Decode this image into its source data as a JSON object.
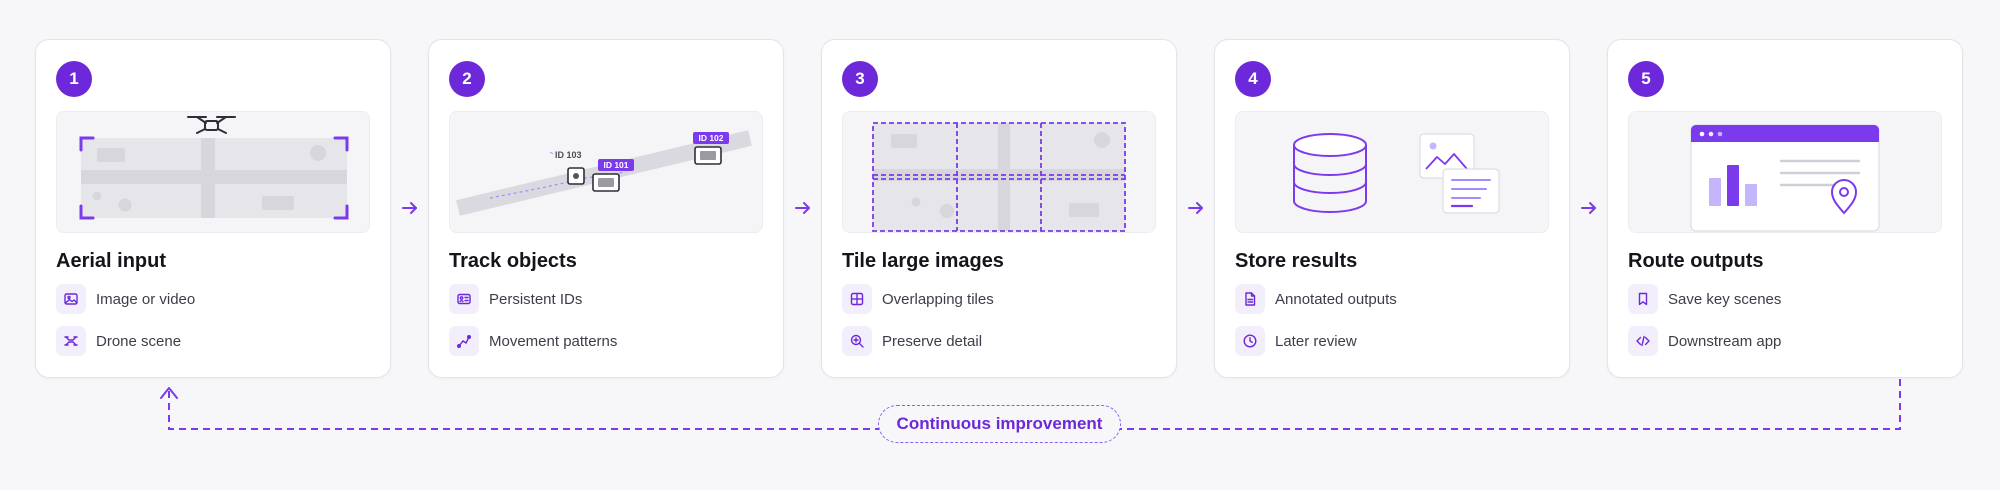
{
  "colors": {
    "accent": "#7c3aed",
    "accent_dark": "#6d28d9",
    "accent_light": "#c4b5fd",
    "card_bg": "#ffffff",
    "page_bg": "#f7f7f9",
    "illustration_bg": "#f5f5f8",
    "icon_bg": "#f2eefb"
  },
  "steps": [
    {
      "number": "1",
      "title": "Aerial input",
      "illustration": "drone-over-map",
      "features": [
        {
          "icon": "image-icon",
          "label": "Image or video"
        },
        {
          "icon": "drone-icon",
          "label": "Drone scene"
        }
      ]
    },
    {
      "number": "2",
      "title": "Track objects",
      "illustration": "tracked-objects-on-road",
      "tags": [
        "ID 103",
        "ID 101",
        "ID 102"
      ],
      "features": [
        {
          "icon": "id-card-icon",
          "label": "Persistent IDs"
        },
        {
          "icon": "path-icon",
          "label": "Movement patterns"
        }
      ]
    },
    {
      "number": "3",
      "title": "Tile large images",
      "illustration": "tiled-map-grid",
      "features": [
        {
          "icon": "grid-icon",
          "label": "Overlapping tiles"
        },
        {
          "icon": "zoom-in-icon",
          "label": "Preserve detail"
        }
      ]
    },
    {
      "number": "4",
      "title": "Store results",
      "illustration": "database-and-documents",
      "features": [
        {
          "icon": "document-icon",
          "label": "Annotated outputs"
        },
        {
          "icon": "clock-icon",
          "label": "Later review"
        }
      ]
    },
    {
      "number": "5",
      "title": "Route outputs",
      "illustration": "app-dashboard-with-pin",
      "features": [
        {
          "icon": "bookmark-icon",
          "label": "Save key scenes"
        },
        {
          "icon": "code-icon",
          "label": "Downstream app"
        }
      ]
    }
  ],
  "flow_arrows": [
    "arrow-right-icon",
    "arrow-right-icon",
    "arrow-right-icon",
    "arrow-right-icon"
  ],
  "loop": {
    "label": "Continuous improvement"
  }
}
